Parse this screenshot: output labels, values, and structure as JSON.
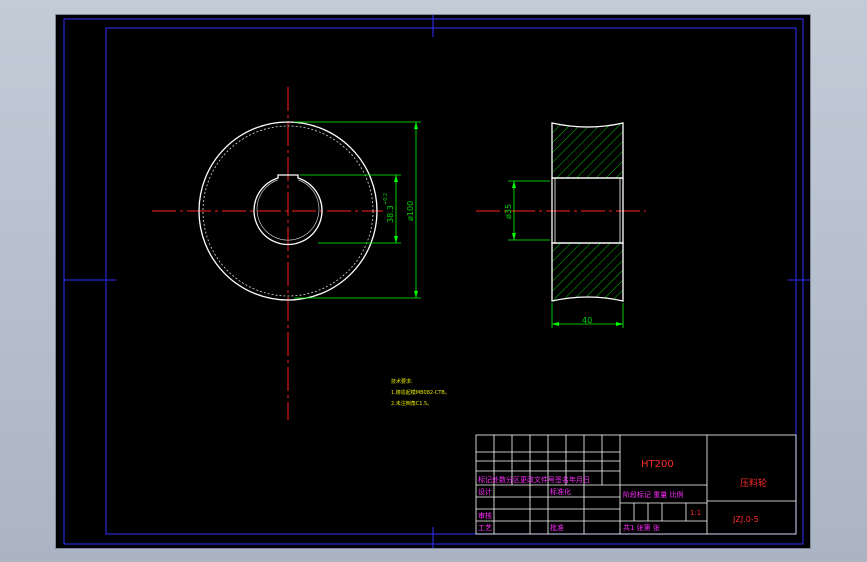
{
  "drawing": {
    "dimensions": {
      "outer_diameter": "ø100",
      "keyway_depth": "38.3",
      "keyway_tolerance": "+0.2",
      "bore_diameter": "ø35",
      "width": "40"
    },
    "tech_notes": {
      "heading": "技术要求:",
      "line1": "1.铸造起模MB082-CTB。",
      "line2": "2.未注倒角C1.5。"
    },
    "title_block": {
      "material": "HT200",
      "part_name": "压料轮",
      "drawing_number": "JZJ.0-5",
      "scale": "1:1",
      "revision_header": "标记处数分区更改文件号签名年月日",
      "stage_header": "阶段标记 重量 比例",
      "design_label": "设计",
      "standardize_label": "标准化",
      "review_label": "审核",
      "process_label": "工艺",
      "approve_label": "批准",
      "sheet_info": "共1 张第 张"
    },
    "colors": {
      "frame": "#0000ff",
      "outline": "#ffffff",
      "centerline": "#ff0000",
      "dimension": "#00ff00",
      "hatch": "#00c000",
      "notes": "#ffff00",
      "titleblock_text": "#ff00ff"
    }
  }
}
